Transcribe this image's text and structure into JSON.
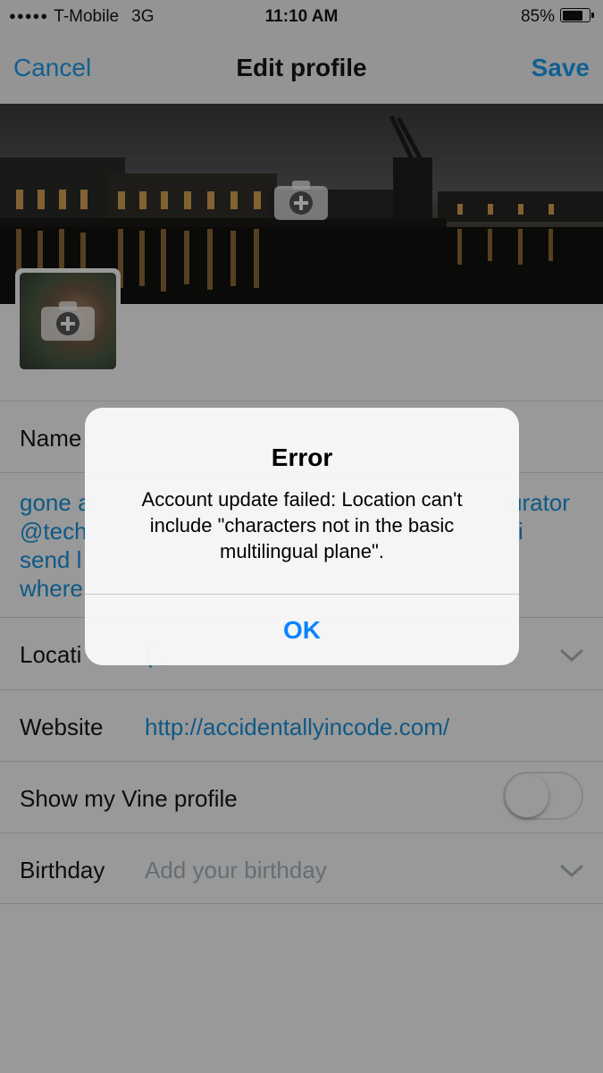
{
  "status_bar": {
    "signal": "●●●●●",
    "carrier": "T-Mobile",
    "network": "3G",
    "time": "11:10 AM",
    "battery_text": "85%",
    "battery_level": 0.85
  },
  "nav": {
    "cancel": "Cancel",
    "title": "Edit profile",
    "save": "Save",
    "accent_color": "#1da1f2"
  },
  "header": {
    "camera_icon": "camera-add-icon"
  },
  "avatar": {
    "camera_icon": "camera-add-icon"
  },
  "form": {
    "name_label": "Name",
    "bio_lines_left": [
      "gone a",
      "@tech",
      "send l",
      "where"
    ],
    "bio_right_1": "urator",
    "bio_right_2": "i",
    "location_label": "Locati",
    "location_value_partial": "( , ",
    "website_label": "Website",
    "website_value": "http://accidentallyincode.com/",
    "vine_label": "Show my Vine profile",
    "vine_toggle_on": false,
    "birthday_label": "Birthday",
    "birthday_placeholder": "Add your birthday",
    "chevron_icon": "chevron-down-icon"
  },
  "alert": {
    "title": "Error",
    "message": "Account update failed: Location can't include \"characters not in the basic multilingual plane\".",
    "ok": "OK",
    "button_color": "#0a84ff"
  }
}
